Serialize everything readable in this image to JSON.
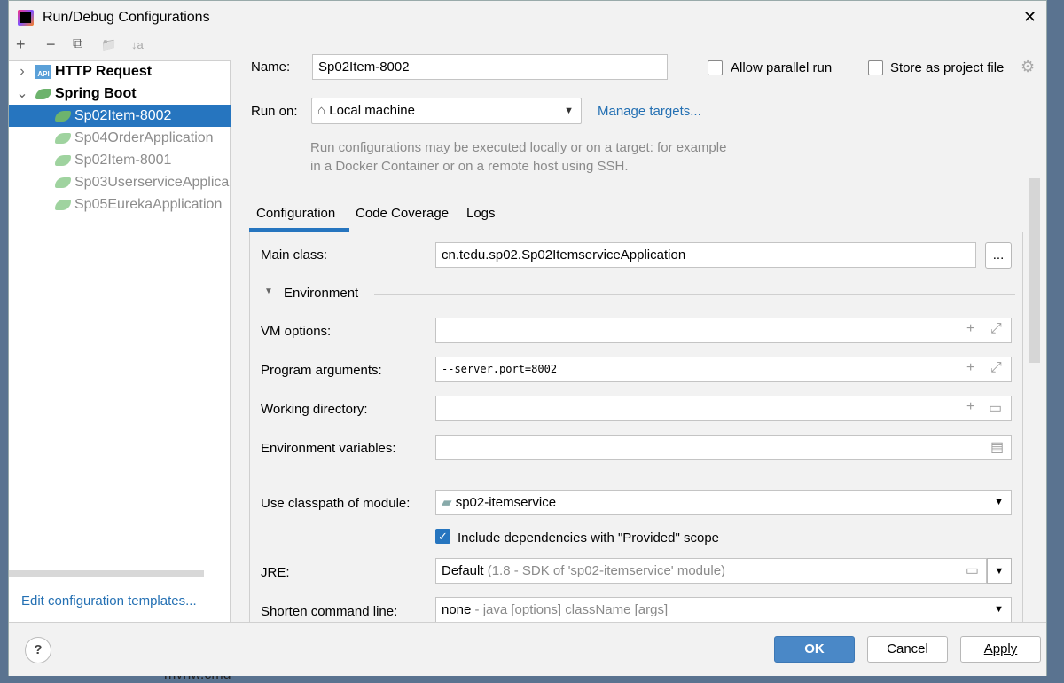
{
  "window": {
    "title": "Run/Debug Configurations",
    "close": "✕"
  },
  "toolbar": {
    "add": "+",
    "remove": "−",
    "copy": "⧉",
    "folder": "📁",
    "sort": "↓a"
  },
  "tree": {
    "groups": [
      {
        "label": "HTTP Request",
        "expanded": false
      },
      {
        "label": "Spring Boot",
        "expanded": true
      }
    ],
    "items": [
      "Sp02Item-8002",
      "Sp04OrderApplication",
      "Sp02Item-8001",
      "Sp03UserserviceApplica",
      "Sp05EurekaApplication"
    ],
    "selected": 0
  },
  "edit_templates": "Edit configuration templates...",
  "form": {
    "name_label": "Name:",
    "name_value": "Sp02Item-8002",
    "allow_parallel": "Allow parallel run",
    "allow_parallel_checked": false,
    "store_project": "Store as project file",
    "store_project_checked": false,
    "run_on_label": "Run on:",
    "run_on_value": "Local machine",
    "manage_targets": "Manage targets...",
    "hint": "Run configurations may be executed locally or on a target: for example in a Docker Container or on a remote host using SSH."
  },
  "tabs": [
    "Configuration",
    "Code Coverage",
    "Logs"
  ],
  "active_tab": 0,
  "config": {
    "main_class_label": "Main class:",
    "main_class_value": "cn.tedu.sp02.Sp02ItemserviceApplication",
    "browse": "...",
    "environment": "Environment",
    "vm_label": "VM options:",
    "vm_value": "",
    "prog_label": "Program arguments:",
    "prog_value": "--server.port=8002",
    "wd_label": "Working directory:",
    "wd_value": "",
    "env_label": "Environment variables:",
    "env_value": "",
    "module_label": "Use classpath of module:",
    "module_value": "sp02-itemservice",
    "include_deps": "Include dependencies with \"Provided\" scope",
    "include_deps_checked": true,
    "jre_label": "JRE:",
    "jre_value": "Default",
    "jre_hint": "(1.8 - SDK of 'sp02-itemservice' module)",
    "shorten_label": "Shorten command line:",
    "shorten_value": "none",
    "shorten_hint": "- java [options] className [args]"
  },
  "buttons": {
    "help": "?",
    "ok": "OK",
    "cancel": "Cancel",
    "apply": "Apply"
  },
  "background": {
    "file": "mvnw.cmd"
  },
  "colors": {
    "accent": "#2675bf",
    "ok": "#4a88c7",
    "link": "#2470b3"
  }
}
